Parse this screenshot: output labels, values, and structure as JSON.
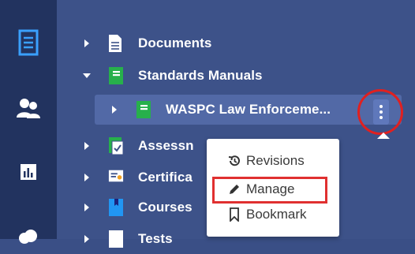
{
  "tree": {
    "items": [
      {
        "label": "Documents"
      },
      {
        "label": "Standards Manuals"
      },
      {
        "label": "WASPC Law Enforceme..."
      },
      {
        "label": "Assessn"
      },
      {
        "label": "Certifica"
      },
      {
        "label": "Courses"
      },
      {
        "label": "Tests"
      }
    ]
  },
  "menu": {
    "revisions": "Revisions",
    "manage": "Manage",
    "bookmark": "Bookmark"
  },
  "colors": {
    "rail": "#22335f",
    "tree": "#3d5289",
    "selected_row": "#5269a6",
    "highlight": "#e02020",
    "book_green": "#27b04b"
  }
}
